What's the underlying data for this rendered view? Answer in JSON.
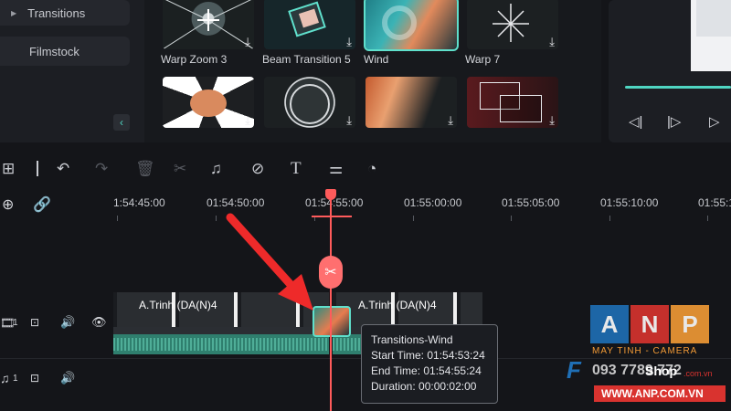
{
  "sidebar": {
    "items": [
      {
        "label": "Transitions",
        "expanded": false
      },
      {
        "label": "Filmstock"
      }
    ],
    "collapse_icon": "chevron-left-icon"
  },
  "transitions_grid": {
    "row1": [
      {
        "label": "Warp Zoom 3",
        "selected": false
      },
      {
        "label": "Beam Transition 5",
        "selected": false
      },
      {
        "label": "Wind",
        "selected": true
      },
      {
        "label": "Warp 7",
        "selected": false
      }
    ],
    "row2_count": 4,
    "download_icon": "download-icon"
  },
  "preview": {
    "progress": 1.0,
    "controls": [
      "step-back-icon",
      "play-icon",
      "play-forward-icon"
    ]
  },
  "toolbar": {
    "tools": [
      "layout-icon",
      "undo-icon",
      "redo-icon",
      "delete-icon",
      "cut-icon",
      "audio-icon",
      "tag-icon",
      "text-icon",
      "adjust-icon",
      "speed-icon"
    ]
  },
  "ruler": {
    "ticks": [
      "1:54:45:00",
      "01:54:50:00",
      "01:54:55:00",
      "01:55:00:00",
      "01:55:05:00",
      "01:55:10:00",
      "01:55:1"
    ]
  },
  "tracks": {
    "video": {
      "number": "1"
    },
    "audio": {
      "number": "1"
    }
  },
  "clips": [
    {
      "name": "A.Trinh (DA(N)4"
    },
    {
      "name": "A.Trinh (DA(N)4"
    }
  ],
  "tooltip": {
    "title": "Transitions-Wind",
    "start": "Start Time: 01:54:53:24",
    "end": "End Time: 01:54:55:24",
    "duration": "Duration: 00:00:02:00"
  },
  "watermark": {
    "letters": [
      "A",
      "N",
      "P"
    ],
    "tagline": "MAY TINH - CAMERA",
    "phone": "093 7789 772",
    "site": "WWW.ANP.COM.VN",
    "shop": "Shop",
    "shop_domain": ".com.vn",
    "colors": {
      "blue": "#1f6fb6",
      "red": "#d9332f",
      "orange": "#f29a35"
    }
  }
}
